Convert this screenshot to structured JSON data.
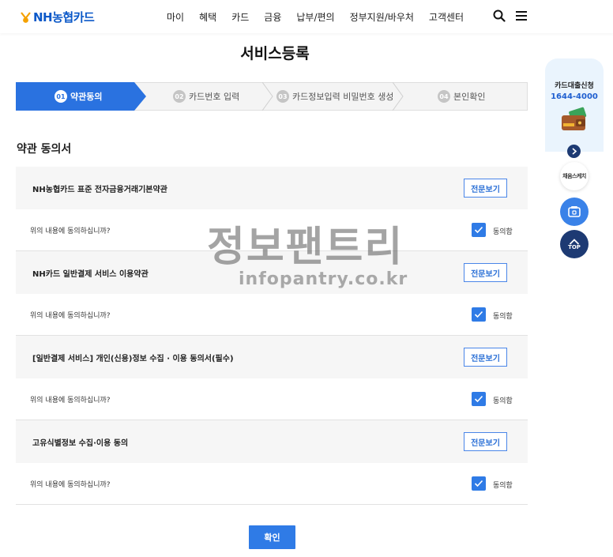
{
  "header": {
    "logo_text": "NH농협카드",
    "nav": [
      "마이",
      "혜택",
      "카드",
      "금융",
      "납부/편의",
      "정부지원/바우처",
      "고객센터"
    ]
  },
  "page_title": "서비스등록",
  "steps": [
    {
      "num": "01",
      "label": "약관동의",
      "active": true
    },
    {
      "num": "02",
      "label": "카드번호 입력",
      "active": false
    },
    {
      "num": "03",
      "label": "카드정보입력 비밀번호 생성",
      "active": false
    },
    {
      "num": "04",
      "label": "본인확인",
      "active": false
    }
  ],
  "section_title": "약관 동의서",
  "terms": [
    {
      "title": "NH농협카드 표준 전자금융거래기본약관",
      "view_label": "전문보기",
      "question": "위의 내용에 동의하십니까?",
      "agree_label": "동의함",
      "checked": true
    },
    {
      "title": "NH카드 일반결제 서비스 이용약관",
      "view_label": "전문보기",
      "question": "위의 내용에 동의하십니까?",
      "agree_label": "동의함",
      "checked": true
    },
    {
      "title": "[일반결제 서비스] 개인(신용)정보 수집 · 이용 동의서(필수)",
      "view_label": "전문보기",
      "question": "위의 내용에 동의하십니까?",
      "agree_label": "동의함",
      "checked": true
    },
    {
      "title": "고유식별정보 수집·이용 동의",
      "view_label": "전문보기",
      "question": "위의 내용에 동의하십니까?",
      "agree_label": "동의함",
      "checked": true
    }
  ],
  "confirm_label": "확인",
  "floating": {
    "loan_title": "카드대출신청",
    "loan_phone": "1644-4000",
    "chatbot_label": "채움스케치",
    "top_label": "TOP"
  },
  "watermark": {
    "main": "정보팬트리",
    "sub": "infopantry.co.kr"
  },
  "colors": {
    "brand": "#0a58c8",
    "accent": "#2f7be6",
    "active_step": "#2a72e0"
  }
}
